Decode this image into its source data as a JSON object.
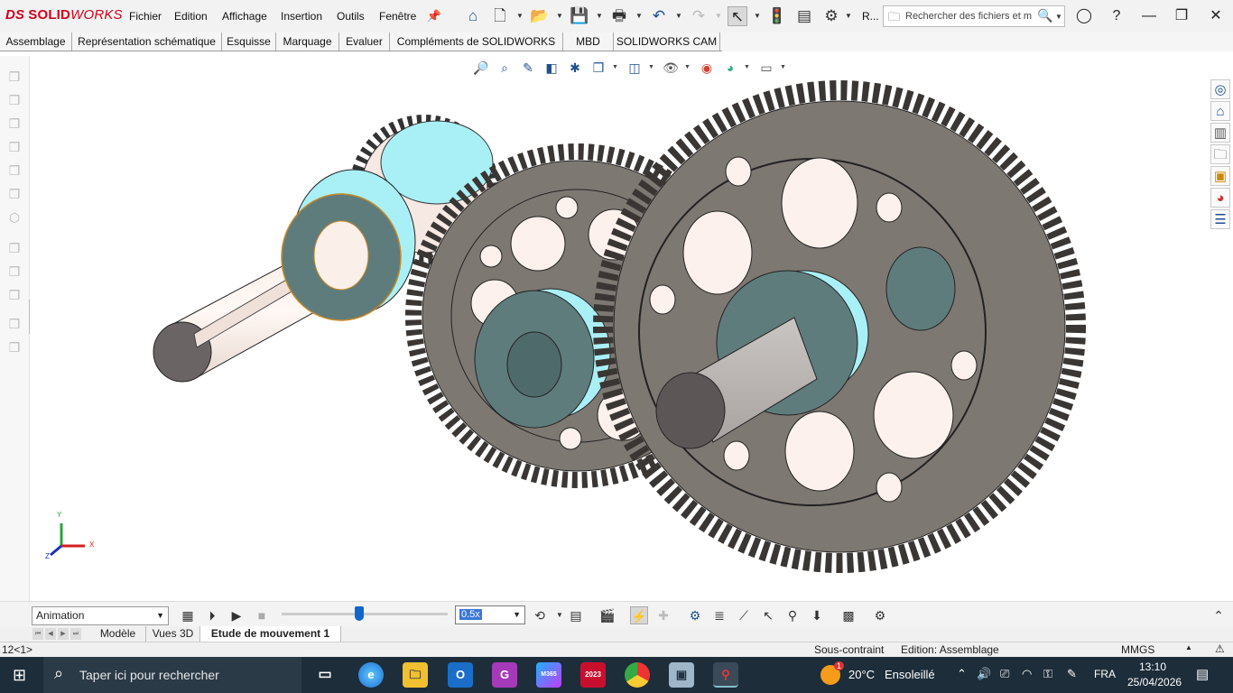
{
  "app": {
    "brand": "SOLIDWORKS",
    "brand_prefix": "DS",
    "brand_solid": "SOLID",
    "brand_works": "WORKS"
  },
  "menu": [
    "Fichier",
    "Edition",
    "Affichage",
    "Insertion",
    "Outils",
    "Fenêtre"
  ],
  "toolbar": {
    "icons": [
      "home-icon",
      "new-document-icon",
      "open-icon",
      "save-icon",
      "print-icon",
      "undo-icon",
      "redo-icon",
      "select-icon",
      "traffic-light-icon",
      "file-properties-icon",
      "options-icon"
    ],
    "rebuild_label": "R..."
  },
  "search": {
    "placeholder": "Rechercher des fichiers et m"
  },
  "command_tabs": [
    "Assemblage",
    "Représentation schématique",
    "Esquisse",
    "Marquage",
    "Evaluer",
    "Compléments de SOLIDWORKS",
    "MBD",
    "SOLIDWORKS CAM"
  ],
  "triad": {
    "x": "X",
    "y": "Y",
    "z": "Z"
  },
  "motion": {
    "study_type": "Animation",
    "speed": "0.5x",
    "slider_position": 0.47
  },
  "bottom_tabs": [
    "Modèle",
    "Vues 3D",
    "Etude de mouvement 1"
  ],
  "active_bottom_tab": "Etude de mouvement 1",
  "status": {
    "left": "12<1>",
    "constraint": "Sous-contraint",
    "edition": "Edition: Assemblage",
    "units": "MMGS"
  },
  "taskbar": {
    "search_placeholder": "Taper ici pour rechercher",
    "apps": [
      {
        "name": "task-view",
        "label": ""
      },
      {
        "name": "edge",
        "label": ""
      },
      {
        "name": "file-explorer",
        "label": ""
      },
      {
        "name": "outlook",
        "label": "O"
      },
      {
        "name": "pdf-gear",
        "label": "G"
      },
      {
        "name": "m365",
        "label": "M365"
      },
      {
        "name": "solidworks-2023",
        "label": "2023"
      },
      {
        "name": "chrome",
        "label": ""
      },
      {
        "name": "image-viewer",
        "label": ""
      },
      {
        "name": "solidworks-active",
        "label": ""
      }
    ],
    "weather_temp": "20°C",
    "weather_text": "Ensoleillé",
    "weather_badge": "1",
    "language": "FRA",
    "time": "13:10",
    "date": "25/04/2026"
  },
  "colors": {
    "brand_red": "#d4001a",
    "gear_grey": "#7e7873",
    "spacer_cyan": "#a9f0f6",
    "spacer_face": "#5f7c7c",
    "taskbar": "#1d2d3a"
  }
}
